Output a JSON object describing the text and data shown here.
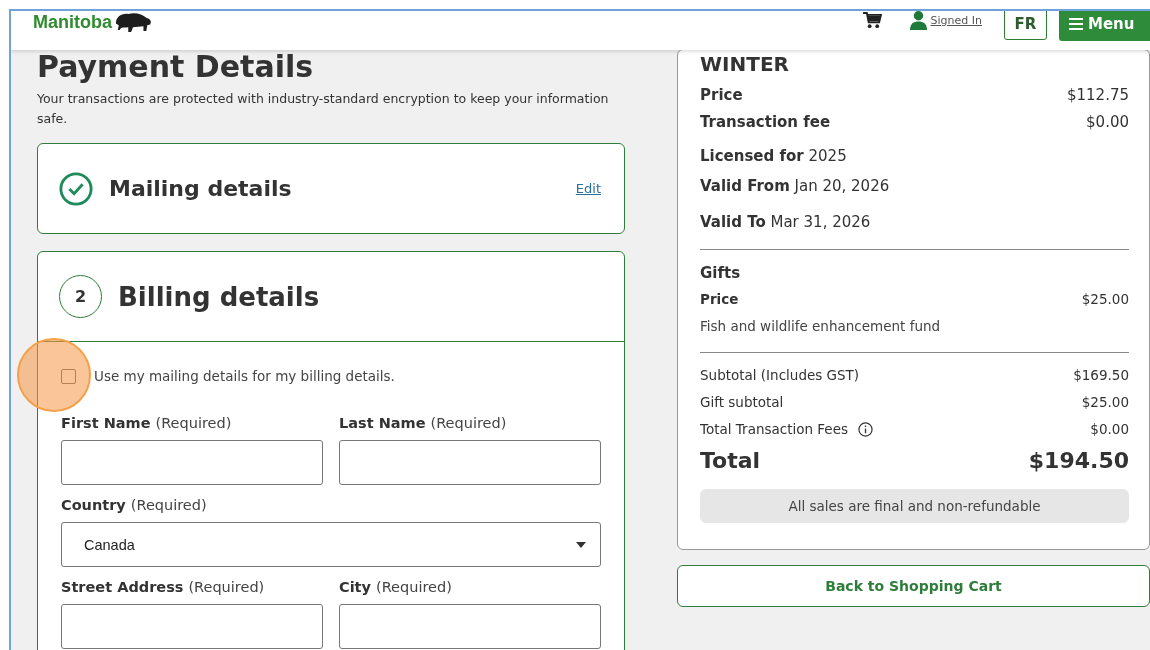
{
  "header": {
    "logo": "Manitoba",
    "account": "Signed In",
    "language": "FR",
    "menu": "Menu"
  },
  "page": {
    "title": "Payment Details",
    "intro": "Your transactions are protected with industry-standard encryption to keep your information safe."
  },
  "sections": [
    {
      "kind": "done",
      "title": "Mailing details",
      "action": "Edit"
    },
    {
      "kind": "step",
      "step": "2",
      "title": "Billing details",
      "same_as_mailing": {
        "label": "Use my mailing details for my billing details.",
        "checked": false
      },
      "fields": [
        {
          "kind": "text",
          "label": "First Name",
          "note": "(Required)"
        },
        {
          "kind": "text",
          "label": "Last Name",
          "note": "(Required)"
        },
        {
          "kind": "select",
          "label": "Country",
          "note": "(Required)",
          "value": "Canada"
        },
        {
          "kind": "text",
          "label": "Street Address",
          "note": "(Required)"
        },
        {
          "kind": "text",
          "label": "City",
          "note": "(Required)"
        }
      ]
    }
  ],
  "summary": {
    "product": "WINTER",
    "lines": [
      {
        "label": "Price",
        "value": "$112.75"
      },
      {
        "label": "Transaction fee",
        "value": "$0.00"
      }
    ],
    "details": [
      "**Licensed for** 2025",
      "**Valid From** Jan 20, 2026",
      "**Valid To** Mar 31, 2026"
    ],
    "gifts": {
      "title": "Gifts",
      "label": "Price",
      "value": "$25.00",
      "description": "Fish and wildlife enhancement fund"
    },
    "totals": [
      {
        "label": "Subtotal (Includes GST)",
        "value": "$169.50",
        "info": false
      },
      {
        "label": "Gift subtotal",
        "value": "$25.00",
        "info": false
      },
      {
        "label": "Total Transaction Fees",
        "value": "$0.00",
        "info": true
      }
    ],
    "total": {
      "label": "Total",
      "value": "$194.50"
    },
    "notice": "All sales are final and non-refundable",
    "back": "Back to Shopping Cart"
  }
}
